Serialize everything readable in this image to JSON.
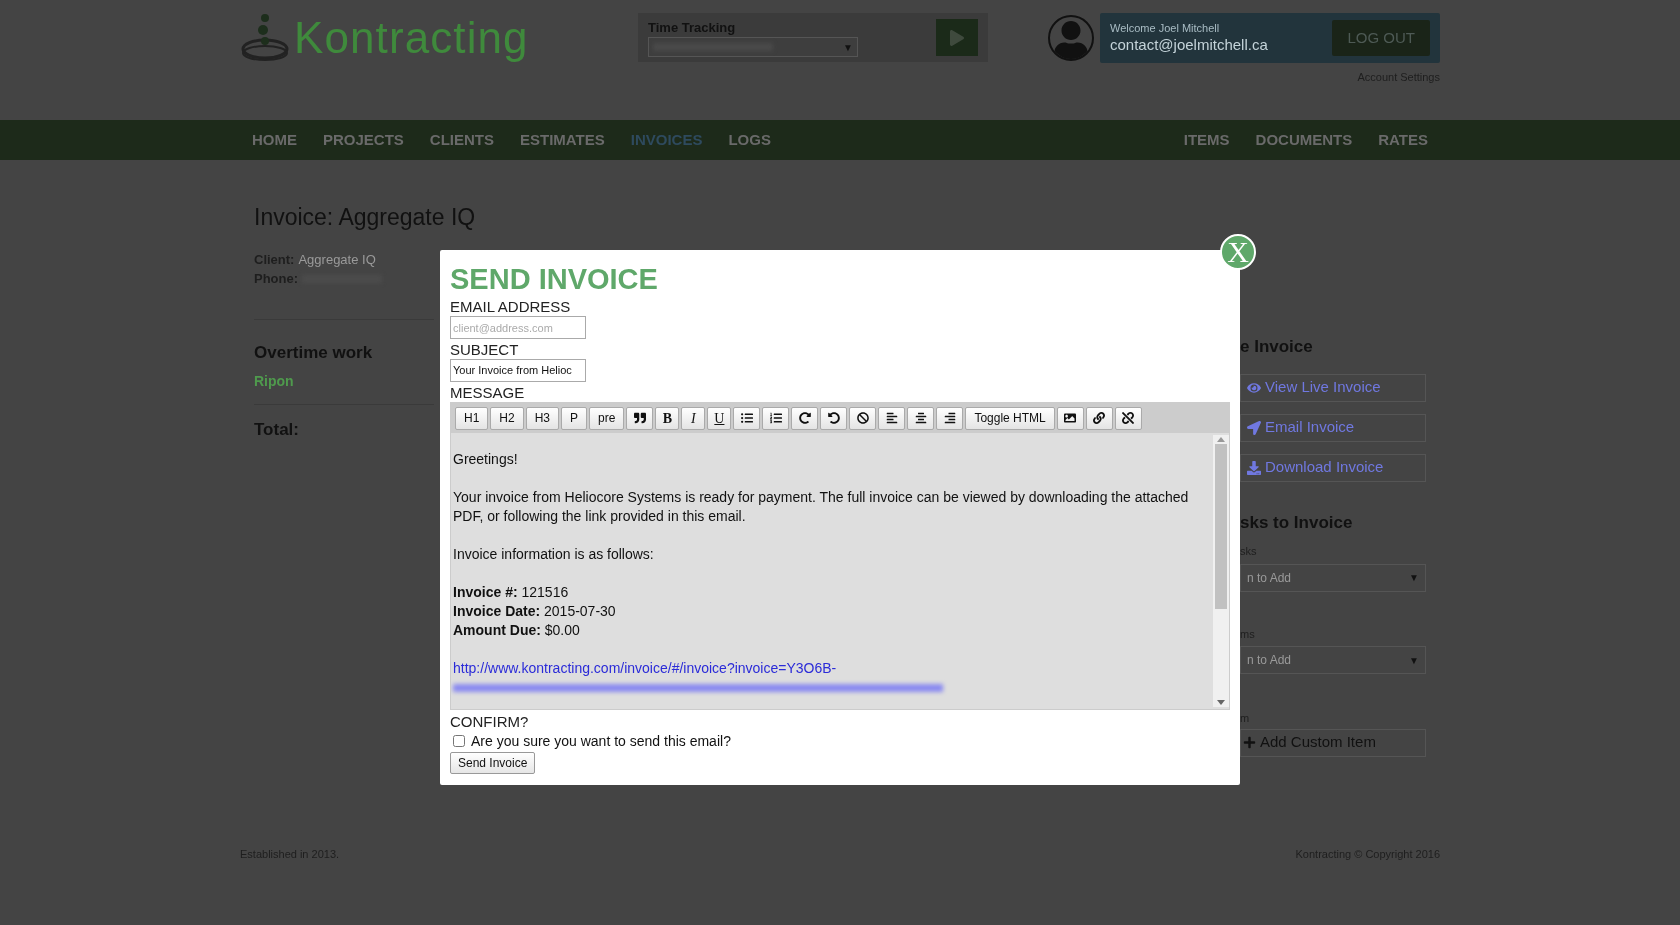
{
  "header": {
    "logo": "Kontracting",
    "time_tracking": {
      "label": "Time Tracking",
      "arrow": "▼"
    },
    "user": {
      "welcome": "Welcome Joel Mitchell",
      "email": "contact@joelmitchell.ca",
      "logout": "LOG OUT",
      "account_settings": "Account Settings"
    }
  },
  "nav": {
    "left": [
      {
        "label": "HOME",
        "selected": false
      },
      {
        "label": "PROJECTS",
        "selected": false
      },
      {
        "label": "CLIENTS",
        "selected": false
      },
      {
        "label": "ESTIMATES",
        "selected": false
      },
      {
        "label": "INVOICES",
        "selected": true
      },
      {
        "label": "LOGS",
        "selected": false
      }
    ],
    "right": [
      {
        "label": "ITEMS",
        "selected": false
      },
      {
        "label": "DOCUMENTS",
        "selected": false
      },
      {
        "label": "RATES",
        "selected": false
      }
    ]
  },
  "invoice": {
    "title": "Invoice: Aggregate IQ",
    "fields": [
      {
        "label": "Client:",
        "value": "Aggregate IQ"
      },
      {
        "label": "Phone:"
      }
    ],
    "item": {
      "title": "Overtime work",
      "client": "Ripon"
    },
    "total": "Total:"
  },
  "side": {
    "heading": "e Invoice",
    "actions": [
      "View Live Invoice",
      "Email Invoice",
      "Download Invoice"
    ],
    "add_heading": "sks to Invoice",
    "selects": [
      {
        "label": "sks",
        "value": "n to Add",
        "arrow": "▼"
      },
      {
        "label": "ms",
        "value": "n to Add",
        "arrow": "▼"
      }
    ],
    "custom_label": "m",
    "custom_button": "Add Custom Item"
  },
  "modal": {
    "close": "X",
    "title": "SEND INVOICE",
    "email_label": "EMAIL ADDRESS",
    "email": {
      "placeholder": "client@address.com"
    },
    "subject_label": "SUBJECT",
    "subject": {
      "value": "Your Invoice from Helioc"
    },
    "message_label": "MESSAGE",
    "toolbar": [
      {
        "kind": "text",
        "label": "H1"
      },
      {
        "kind": "text",
        "label": "H2"
      },
      {
        "kind": "text",
        "label": "H3"
      },
      {
        "kind": "text",
        "label": "P"
      },
      {
        "kind": "text",
        "label": "pre"
      },
      {
        "kind": "icon"
      },
      {
        "kind": "bold",
        "label": "B"
      },
      {
        "kind": "italic",
        "label": "I"
      },
      {
        "kind": "underline",
        "label": "U"
      },
      {
        "kind": "icon"
      },
      {
        "kind": "icon"
      },
      {
        "kind": "icon"
      },
      {
        "kind": "icon"
      },
      {
        "kind": "icon"
      },
      {
        "kind": "icon"
      },
      {
        "kind": "icon"
      },
      {
        "kind": "icon"
      },
      {
        "kind": "text",
        "label": "Toggle HTML"
      },
      {
        "kind": "icon"
      },
      {
        "kind": "icon"
      },
      {
        "kind": "icon"
      }
    ],
    "message": [
      {
        "kind": "text",
        "lines": [
          "Greetings!"
        ]
      },
      {
        "kind": "text",
        "lines": [
          "Your invoice from Heliocore Systems is ready for payment. The full invoice can be viewed by downloading the attached PDF, or following the link provided in this email."
        ]
      },
      {
        "kind": "text",
        "lines": [
          "Invoice information is as follows:"
        ]
      },
      {
        "kind": "text",
        "lines": [
          "**Invoice #:** 121516",
          "**Invoice Date:** 2015-07-30",
          "**Amount Due:** $0.00"
        ]
      },
      {
        "kind": "link",
        "lines": [
          "http://www.kontracting.com/invoice/#/invoice?invoice=Y3O6B-"
        ]
      }
    ],
    "confirm_label": "CONFIRM?",
    "confirm": {
      "label": "Are you sure you want to send this email?",
      "checked": false
    },
    "send": "Send Invoice"
  },
  "footer": {
    "left": "Established in 2013.",
    "right": "Kontracting © Copyright 2016"
  }
}
